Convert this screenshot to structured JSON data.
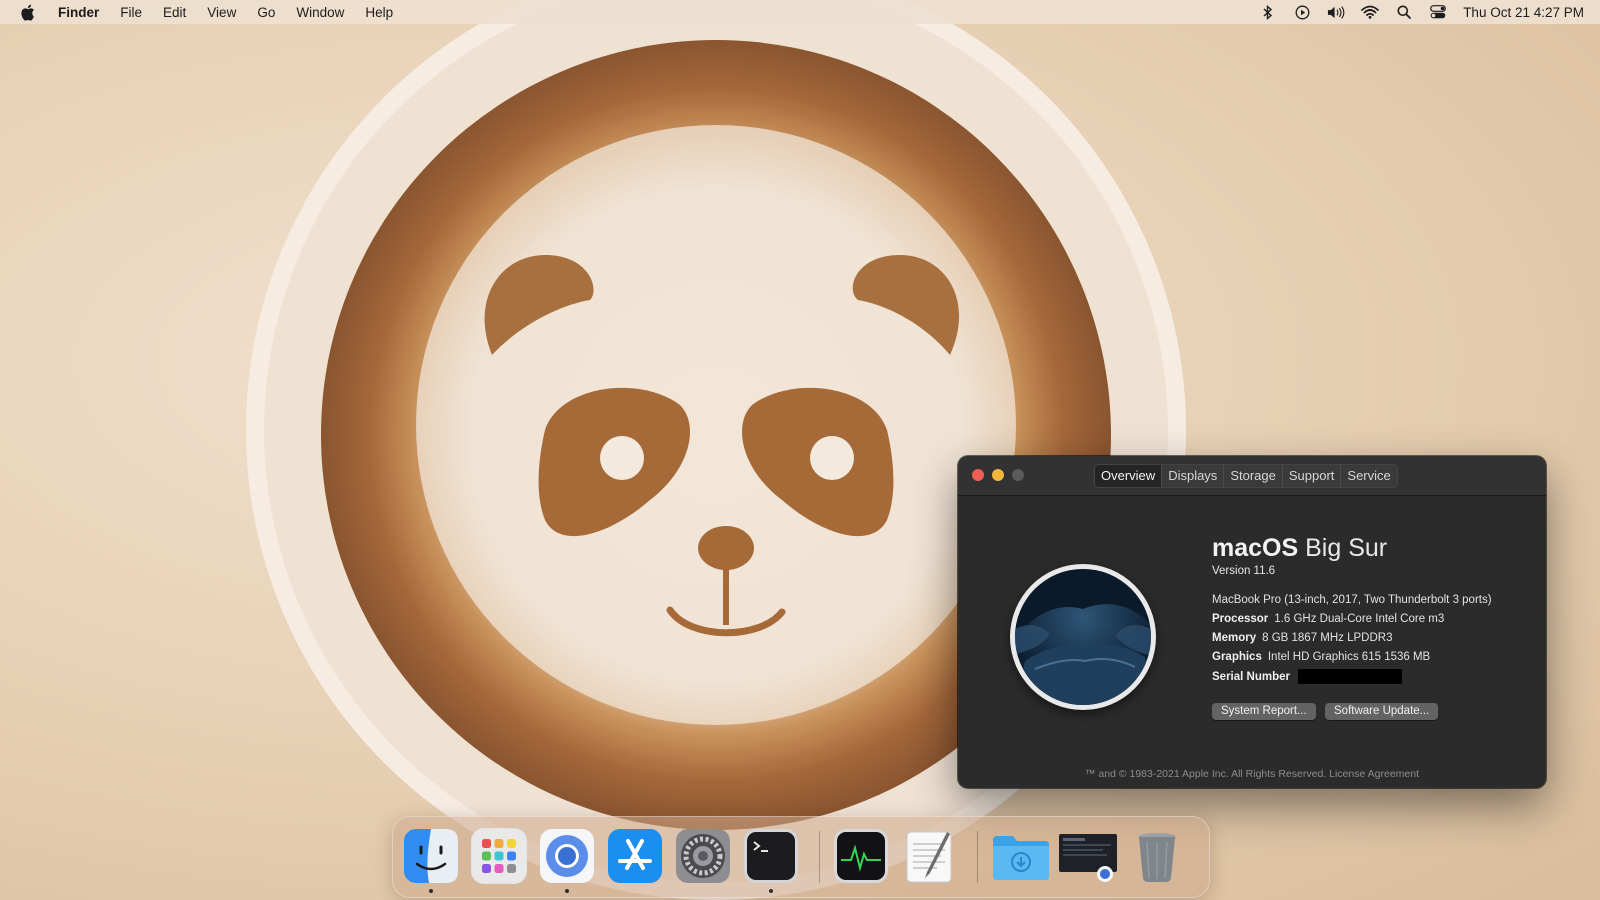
{
  "menubar": {
    "app_name": "Finder",
    "menus": [
      "File",
      "Edit",
      "View",
      "Go",
      "Window",
      "Help"
    ],
    "status_icons": [
      "bluetooth-icon",
      "now-playing-icon",
      "volume-icon",
      "wifi-icon",
      "spotlight-search-icon",
      "control-center-icon"
    ],
    "clock": "Thu Oct 21  4:27 PM"
  },
  "about_window": {
    "tabs": [
      "Overview",
      "Displays",
      "Storage",
      "Support",
      "Service"
    ],
    "active_tab": "Overview",
    "os_name": "macOS",
    "os_release": "Big Sur",
    "version": "Version 11.6",
    "model": "MacBook Pro (13-inch, 2017, Two Thunderbolt 3 ports)",
    "specs": [
      {
        "label": "Processor",
        "value": "1.6 GHz Dual-Core Intel Core m3"
      },
      {
        "label": "Memory",
        "value": "8 GB 1867 MHz LPDDR3"
      },
      {
        "label": "Graphics",
        "value": "Intel HD Graphics 615 1536 MB"
      }
    ],
    "serial_label": "Serial Number",
    "system_report_button": "System Report...",
    "software_update_button": "Software Update...",
    "footer": "™ and © 1983-2021 Apple Inc. All Rights Reserved. License Agreement"
  },
  "dock": {
    "apps": [
      "finder",
      "launchpad",
      "chromium",
      "app-store",
      "system-preferences",
      "terminal",
      "activity-monitor",
      "textedit",
      "downloads",
      "screenshot",
      "trash"
    ],
    "running": [
      "finder",
      "chromium",
      "terminal"
    ]
  }
}
